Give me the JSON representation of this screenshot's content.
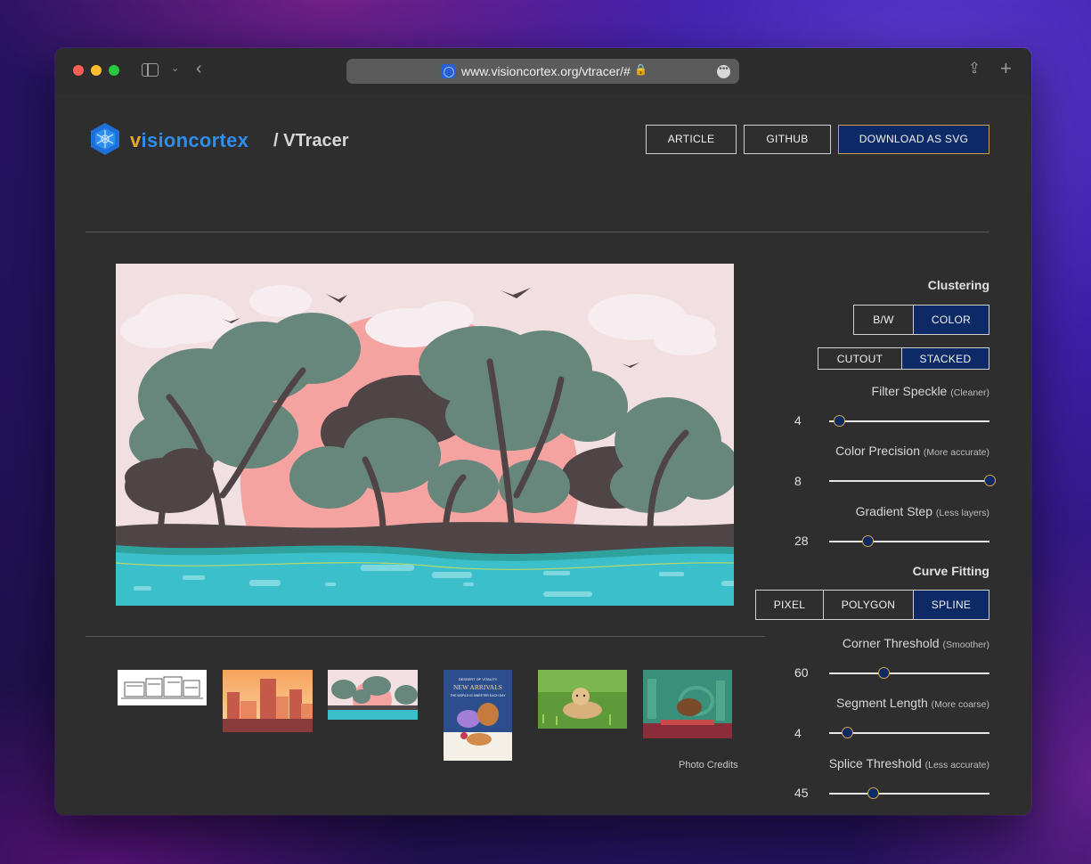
{
  "browser": {
    "url": "www.visioncortex.org/vtracer/#"
  },
  "header": {
    "brand_part1": "v",
    "brand_part2": "isioncortex",
    "product": "/ VTracer",
    "buttons": {
      "article": "ARTICLE",
      "github": "GITHUB",
      "download": "DOWNLOAD AS SVG"
    }
  },
  "gallery": {
    "credits": "Photo Credits"
  },
  "panel": {
    "clustering": {
      "heading": "Clustering",
      "mode_options": [
        "B/W",
        "COLOR"
      ],
      "mode_selected": "COLOR",
      "layer_options": [
        "CUTOUT",
        "STACKED"
      ],
      "layer_selected": "STACKED"
    },
    "sliders_clustering": [
      {
        "label": "Filter Speckle",
        "hint": "(Cleaner)",
        "value": "4",
        "fraction": 0.06
      },
      {
        "label": "Color Precision",
        "hint": "(More accurate)",
        "value": "8",
        "fraction": 1.0
      },
      {
        "label": "Gradient Step",
        "hint": "(Less layers)",
        "value": "28",
        "fraction": 0.24
      }
    ],
    "curve_fitting": {
      "heading": "Curve Fitting",
      "options": [
        "PIXEL",
        "POLYGON",
        "SPLINE"
      ],
      "selected": "SPLINE"
    },
    "sliders_curve": [
      {
        "label": "Corner Threshold",
        "hint": "(Smoother)",
        "value": "60",
        "fraction": 0.34
      },
      {
        "label": "Segment Length",
        "hint": "(More coarse)",
        "value": "4",
        "fraction": 0.11
      },
      {
        "label": "Splice Threshold",
        "hint": "(Less accurate)",
        "value": "45",
        "fraction": 0.27
      }
    ]
  },
  "colors": {
    "accent_active": "#0d2a66",
    "accent_border": "#c9a24a",
    "brand_orange": "#e3a72f",
    "brand_blue": "#2e8ef0"
  }
}
